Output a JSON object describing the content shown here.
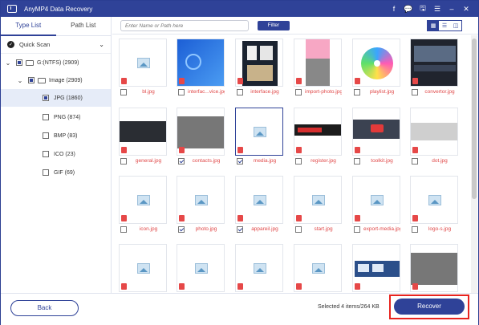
{
  "app": {
    "title": "AnyMP4 Data Recovery"
  },
  "titlebar_controls": [
    "f",
    "💬",
    "🖫",
    "☰",
    "–",
    "✕"
  ],
  "sidebar": {
    "tabs": [
      {
        "label": "Type List",
        "active": true
      },
      {
        "label": "Path List",
        "active": false
      }
    ],
    "quick_scan": "Quick Scan",
    "drive": "G:(NTFS) (2909)",
    "image_folder": "Image (2909)",
    "types": [
      {
        "label": "JPG (1860)",
        "state": "partial",
        "selected": true
      },
      {
        "label": "PNG (874)",
        "state": "none",
        "selected": false
      },
      {
        "label": "BMP (83)",
        "state": "none",
        "selected": false
      },
      {
        "label": "ICO (23)",
        "state": "none",
        "selected": false
      },
      {
        "label": "GIF (69)",
        "state": "none",
        "selected": false
      }
    ]
  },
  "toolbar": {
    "search_placeholder": "Enter Name or Path here",
    "filter_label": "Filter"
  },
  "grid": {
    "files": [
      {
        "name": "bl.jpg",
        "checked": false,
        "thumb": "placeholder"
      },
      {
        "name": "interfac...vice.jpg",
        "checked": false,
        "thumb": "blue"
      },
      {
        "name": "interface.jpg",
        "checked": false,
        "thumb": "interface"
      },
      {
        "name": "import-photo.jpg",
        "checked": false,
        "thumb": "pink"
      },
      {
        "name": "playlist.jpg",
        "checked": false,
        "thumb": "disc"
      },
      {
        "name": "convertor.jpg",
        "checked": false,
        "thumb": "convertor"
      },
      {
        "name": "general.jpg",
        "checked": false,
        "thumb": "dark"
      },
      {
        "name": "contacts.jpg",
        "checked": true,
        "thumb": "gray"
      },
      {
        "name": "media.jpg",
        "checked": true,
        "thumb": "placeholder",
        "selected": true
      },
      {
        "name": "register.jpg",
        "checked": false,
        "thumb": "banner"
      },
      {
        "name": "toolkit.jpg",
        "checked": false,
        "thumb": "toolkit"
      },
      {
        "name": "dot.jpg",
        "checked": false,
        "thumb": "lightgray"
      },
      {
        "name": "icon.jpg",
        "checked": false,
        "thumb": "placeholder"
      },
      {
        "name": "photo.jpg",
        "checked": true,
        "thumb": "placeholder"
      },
      {
        "name": "appareil.jpg",
        "checked": true,
        "thumb": "placeholder"
      },
      {
        "name": "start.jpg",
        "checked": false,
        "thumb": "placeholder"
      },
      {
        "name": "export-media.jpg",
        "checked": false,
        "thumb": "placeholder"
      },
      {
        "name": "logo-s.jpg",
        "checked": false,
        "thumb": "placeholder"
      },
      {
        "name": "",
        "checked": false,
        "thumb": "placeholder"
      },
      {
        "name": "",
        "checked": false,
        "thumb": "placeholder"
      },
      {
        "name": "",
        "checked": false,
        "thumb": "placeholder"
      },
      {
        "name": "",
        "checked": false,
        "thumb": "placeholder"
      },
      {
        "name": "",
        "checked": false,
        "thumb": "screens"
      },
      {
        "name": "",
        "checked": false,
        "thumb": "gray"
      }
    ]
  },
  "footer": {
    "back_label": "Back",
    "status": "Selected 4 items/264 KB",
    "recover_label": "Recover"
  },
  "colors": {
    "brand": "#2f4298",
    "danger": "#e04848",
    "highlight": "#e8241f"
  }
}
